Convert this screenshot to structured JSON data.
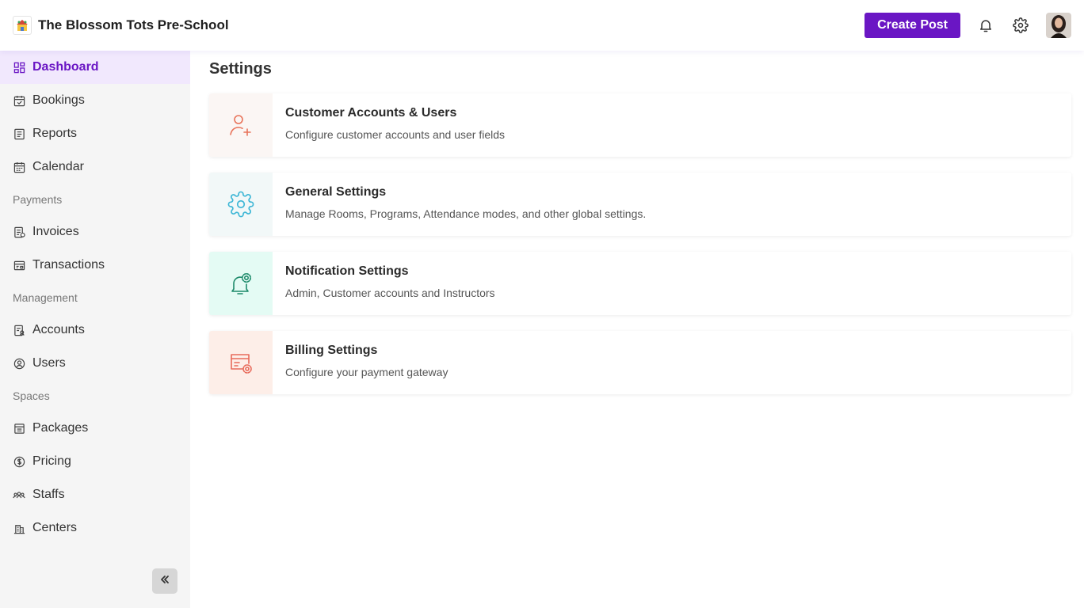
{
  "header": {
    "brand_name": "The Blossom Tots Pre-School",
    "create_post_label": "Create Post",
    "accent_color": "#6a16c4"
  },
  "sidebar": {
    "items": [
      {
        "label": "Dashboard",
        "icon": "dashboard-icon",
        "active": true
      },
      {
        "label": "Bookings",
        "icon": "bookings-icon"
      },
      {
        "label": "Reports",
        "icon": "reports-icon"
      },
      {
        "label": "Calendar",
        "icon": "calendar-icon"
      }
    ],
    "payments_section": "Payments",
    "payments_items": [
      {
        "label": "Invoices",
        "icon": "invoice-icon"
      },
      {
        "label": "Transactions",
        "icon": "transactions-icon"
      }
    ],
    "management_section": "Management",
    "management_items": [
      {
        "label": "Accounts",
        "icon": "accounts-icon"
      },
      {
        "label": "Users",
        "icon": "users-icon"
      }
    ],
    "spaces_section": "Spaces",
    "spaces_items": [
      {
        "label": "Packages",
        "icon": "packages-icon"
      },
      {
        "label": "Pricing",
        "icon": "pricing-icon"
      },
      {
        "label": "Staffs",
        "icon": "staffs-icon"
      },
      {
        "label": "Centers",
        "icon": "centers-icon"
      }
    ]
  },
  "main": {
    "title": "Settings",
    "cards": [
      {
        "title": "Customer Accounts & Users",
        "description": "Configure customer accounts and user fields",
        "icon": "add-user-icon",
        "icon_color": "#e8735a",
        "icon_bg": "#fbf6f4"
      },
      {
        "title": "General Settings",
        "description": "Manage Rooms, Programs, Attendance modes, and other global settings.",
        "icon": "gear-icon",
        "icon_color": "#3fb7d6",
        "icon_bg": "#f2f8f8"
      },
      {
        "title": "Notification Settings",
        "description": "Admin, Customer accounts and Instructors",
        "icon": "bell-gear-icon",
        "icon_color": "#1d8a6a",
        "icon_bg": "#e4fbf4"
      },
      {
        "title": "Billing Settings",
        "description": "Configure your payment gateway",
        "icon": "billing-gear-icon",
        "icon_color": "#e86a5a",
        "icon_bg": "#fdeee8"
      }
    ]
  }
}
